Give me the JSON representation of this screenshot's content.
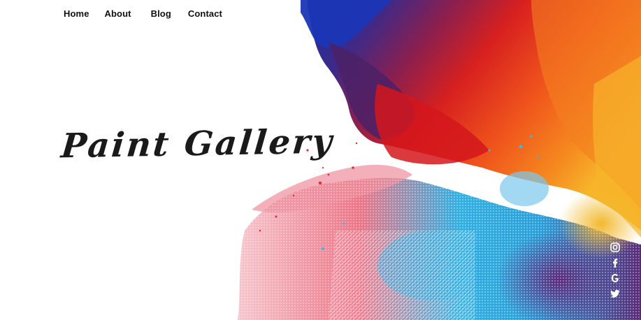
{
  "nav": {
    "items": [
      {
        "label": "Home"
      },
      {
        "label": "About"
      },
      {
        "label": "Blog"
      },
      {
        "label": "Contact"
      }
    ]
  },
  "hero": {
    "title": "Paint Gallery"
  },
  "social": {
    "icons": [
      "instagram-icon",
      "facebook-icon",
      "google-plus-icon",
      "twitter-icon"
    ]
  },
  "colors": {
    "text": "#111111",
    "background": "#ffffff",
    "paint_blue": "#1a2fa0",
    "paint_purple": "#4a1f6e",
    "paint_red": "#d71f24",
    "paint_orange": "#f26a1b",
    "paint_yellow": "#f5b22a",
    "paint_pink": "#ef7d8f",
    "paint_cyan": "#2bb3e6"
  }
}
